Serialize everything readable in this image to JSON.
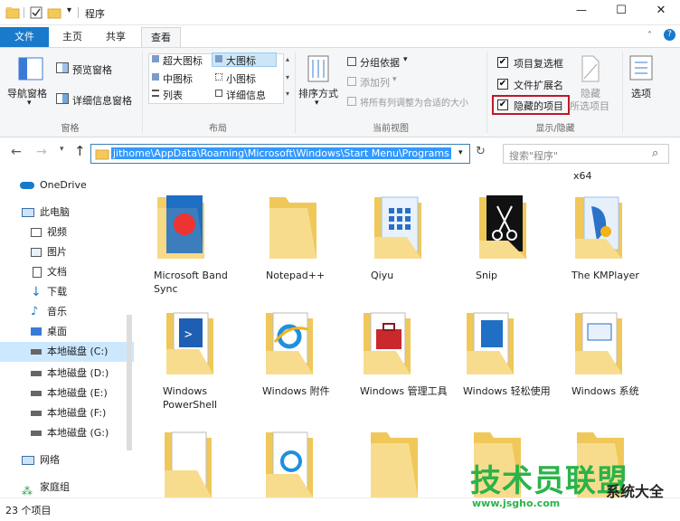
{
  "window": {
    "title": "程序",
    "controls": [
      "—",
      "☐",
      "✕"
    ]
  },
  "menu_tabs": [
    {
      "label": "文件"
    },
    {
      "label": "主页"
    },
    {
      "label": "共享"
    },
    {
      "label": "查看"
    }
  ],
  "ribbon": {
    "pane": {
      "nav_pane": "导航窗格",
      "preview_pane": "预览窗格",
      "details_pane": "详细信息窗格",
      "group_label": "窗格"
    },
    "layout": {
      "items": [
        "超大图标",
        "大图标",
        "中图标",
        "小图标",
        "列表",
        "详细信息"
      ],
      "group_label": "布局"
    },
    "current_view": {
      "sort_by": "排序方式",
      "group_by": "分组依据",
      "add_column": "添加列",
      "fit_columns": "将所有列调整为合适的大小",
      "group_label": "当前视图"
    },
    "show_hide": {
      "item_checkboxes": "项目复选框",
      "file_extensions": "文件扩展名",
      "hidden_items": "隐藏的项目",
      "hide_selected": "隐藏",
      "hide_selected_line2": "所选项目",
      "options": "选项",
      "group_label": "显示/隐藏"
    }
  },
  "address": {
    "path": "jithome\\AppData\\Roaming\\Microsoft\\Windows\\Start Menu\\Programs",
    "search_placeholder": "搜索\"程序\""
  },
  "nav": {
    "items": [
      {
        "label": "OneDrive"
      },
      {
        "label": "此电脑"
      },
      {
        "label": "视频"
      },
      {
        "label": "图片"
      },
      {
        "label": "文档"
      },
      {
        "label": "下载"
      },
      {
        "label": "音乐"
      },
      {
        "label": "桌面"
      },
      {
        "label": "本地磁盘 (C:)"
      },
      {
        "label": "本地磁盘 (D:)"
      },
      {
        "label": "本地磁盘 (E:)"
      },
      {
        "label": "本地磁盘 (F:)"
      },
      {
        "label": "本地磁盘 (G:)"
      },
      {
        "label": "网络"
      },
      {
        "label": "家庭组"
      }
    ]
  },
  "files": {
    "extra_label": "x64",
    "row1": [
      {
        "label": "Microsoft Band Sync"
      },
      {
        "label": "Notepad++"
      },
      {
        "label": "Qiyu"
      },
      {
        "label": "Snip"
      },
      {
        "label": "The KMPlayer"
      }
    ],
    "row2": [
      {
        "label": "Windows PowerShell"
      },
      {
        "label": "Windows 附件"
      },
      {
        "label": "Windows 管理工具"
      },
      {
        "label": "Windows 轻松使用"
      },
      {
        "label": "Windows 系统"
      }
    ]
  },
  "status": {
    "count": "23 个项目"
  },
  "watermark": {
    "text": "技术员联盟",
    "url": "www.jsgho.com",
    "extra": "系统大全"
  }
}
